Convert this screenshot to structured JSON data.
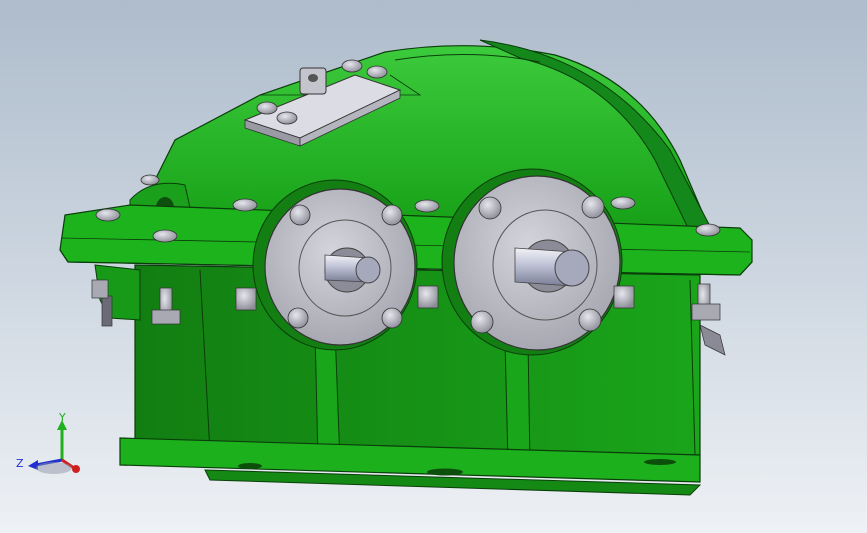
{
  "viewport": {
    "model": "gearbox-assembly",
    "body_color": "#1fa51f",
    "cover_color": "#c8c8d0",
    "background_top": "#aebccb",
    "background_bottom": "#eef1f5"
  },
  "triad": {
    "y_label": "Y",
    "z_label": "Z",
    "y_color": "#1fb01f",
    "z_color": "#1f2fd0",
    "x_color": "#d01f1f"
  }
}
